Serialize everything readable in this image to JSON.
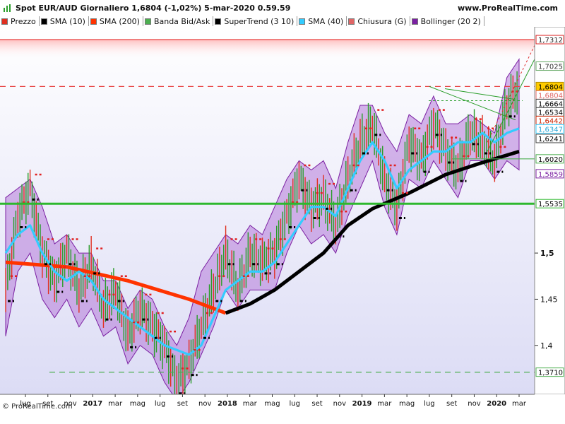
{
  "header": {
    "title": "Spot EUR/AUD Giornaliero 1,6804 (-1,02%) 5-mar-2020 0.59.59",
    "site": "www.ProRealTime.com"
  },
  "legend": [
    {
      "label": "Prezzo",
      "icon": "candle-icon",
      "color": "#e03020"
    },
    {
      "label": "SMA (10)",
      "icon": "sma10-icon",
      "color": "#000000"
    },
    {
      "label": "SMA (200)",
      "icon": "sma200-icon",
      "color": "#ff3300"
    },
    {
      "label": "Banda Bid/Ask",
      "icon": "bidask-icon",
      "color": "#4caf50"
    },
    {
      "label": "SuperTrend (3 10)",
      "icon": "supertrend-icon",
      "color": "#000000"
    },
    {
      "label": "SMA (40)",
      "icon": "sma40-icon",
      "color": "#33ccff"
    },
    {
      "label": "Chiusura (G)",
      "icon": "close-icon",
      "color": "#e06666"
    },
    {
      "label": "Bollinger (20 2)",
      "icon": "bollinger-icon",
      "color": "#7b1fa2"
    }
  ],
  "copyright": "© ProRealTime.com",
  "chart_data": {
    "type": "line",
    "ylim": [
      1.347,
      1.745
    ],
    "y_ticks": [
      "1,5",
      "1,45",
      "1,4"
    ],
    "y_tick_values": [
      1.5,
      1.45,
      1.4
    ],
    "x_labels": [
      "lug",
      "set",
      "nov",
      "2017",
      "mar",
      "mag",
      "lug",
      "set",
      "nov",
      "2018",
      "mar",
      "mag",
      "lug",
      "set",
      "nov",
      "2019",
      "mar",
      "mag",
      "lug",
      "set",
      "nov",
      "2020",
      "mar"
    ],
    "x_labels_bold": [
      "2017",
      "2018",
      "2019",
      "2020"
    ],
    "price_tags": [
      {
        "label": "1,7312",
        "value": 1.7312,
        "bg": "#ffffff",
        "fg": "#222222",
        "border": "#d22"
      },
      {
        "label": "1,7025",
        "value": 1.7025,
        "bg": "#ffffff",
        "fg": "#333333",
        "border": "#6a6"
      },
      {
        "label": "1,6804",
        "value": 1.6804,
        "bg": "#ffcc00",
        "fg": "#000000",
        "border": "#b08a00"
      },
      {
        "label": "1,6804",
        "value": 1.676,
        "bg": "#ffffff",
        "fg": "#e06666",
        "border": "#e06666"
      },
      {
        "label": "1,6664",
        "value": 1.6664,
        "bg": "#ffffff",
        "fg": "#000000",
        "border": "#444"
      },
      {
        "label": "1,6534",
        "value": 1.6534,
        "bg": "#ffffff",
        "fg": "#000000",
        "border": "#444"
      },
      {
        "label": "1,6442",
        "value": 1.6442,
        "bg": "#ffffff",
        "fg": "#cc2200",
        "border": "#cc2200"
      },
      {
        "label": "1,6347",
        "value": 1.6347,
        "bg": "#ffffff",
        "fg": "#2aa8d8",
        "border": "#33ccff"
      },
      {
        "label": "1,6241",
        "value": 1.6241,
        "bg": "#ffffff",
        "fg": "#000000",
        "border": "#444"
      },
      {
        "label": "1,6020",
        "value": 1.602,
        "bg": "#ffffff",
        "fg": "#000000",
        "border": "#4caf50"
      },
      {
        "label": "1,5859",
        "value": 1.5859,
        "bg": "#ffffff",
        "fg": "#7b1fa2",
        "border": "#7b1fa2"
      },
      {
        "label": "1,5535",
        "value": 1.5535,
        "bg": "#ffffff",
        "fg": "#000000",
        "border": "#2db82d"
      },
      {
        "label": "1,3710",
        "value": 1.371,
        "bg": "#ffffff",
        "fg": "#000000",
        "border": "#4caf50"
      }
    ],
    "levels": [
      {
        "value": 1.7312,
        "style": "solid",
        "color": "#e84040"
      },
      {
        "value": 1.6804,
        "style": "dashed",
        "color": "#e84040"
      },
      {
        "value": 1.5535,
        "style": "solid",
        "color": "#2db82d"
      },
      {
        "value": 1.602,
        "style": "solid",
        "color": "#4caf50"
      },
      {
        "value": 1.371,
        "style": "dashed",
        "color": "#4caf50"
      }
    ],
    "series": [
      {
        "name": "SMA (200)",
        "color": "#ff3300",
        "x": [
          0,
          5,
          10,
          15,
          18
        ],
        "y": [
          1.49,
          1.485,
          1.47,
          1.45,
          1.435
        ]
      },
      {
        "name": "SMA (200)",
        "color": "#000000",
        "x": [
          18,
          20,
          22,
          24,
          26,
          28,
          30,
          33,
          36,
          39,
          42
        ],
        "y": [
          1.435,
          1.445,
          1.46,
          1.48,
          1.5,
          1.53,
          1.548,
          1.565,
          1.585,
          1.598,
          1.61
        ]
      },
      {
        "name": "SMA (40)",
        "color": "#33ccff",
        "x": [
          0,
          1,
          2,
          3,
          4,
          5,
          6,
          7,
          8,
          9,
          10,
          11,
          12,
          13,
          14,
          15,
          16,
          17,
          18,
          19,
          20,
          21,
          22,
          23,
          24,
          25,
          26,
          27,
          28,
          29,
          30,
          31,
          32,
          33,
          34,
          35,
          36,
          37,
          38,
          39,
          40,
          41,
          42
        ],
        "y": [
          1.5,
          1.52,
          1.53,
          1.5,
          1.48,
          1.47,
          1.48,
          1.47,
          1.45,
          1.44,
          1.43,
          1.42,
          1.41,
          1.4,
          1.395,
          1.39,
          1.4,
          1.43,
          1.46,
          1.47,
          1.48,
          1.48,
          1.49,
          1.51,
          1.53,
          1.55,
          1.55,
          1.54,
          1.57,
          1.6,
          1.62,
          1.6,
          1.57,
          1.59,
          1.6,
          1.61,
          1.61,
          1.62,
          1.62,
          1.63,
          1.62,
          1.63,
          1.635
        ]
      }
    ],
    "candle_path": [
      1.46,
      1.54,
      1.57,
      1.5,
      1.47,
      1.5,
      1.46,
      1.49,
      1.44,
      1.46,
      1.41,
      1.44,
      1.42,
      1.4,
      1.36,
      1.38,
      1.42,
      1.46,
      1.5,
      1.46,
      1.5,
      1.49,
      1.5,
      1.54,
      1.58,
      1.55,
      1.56,
      1.53,
      1.58,
      1.62,
      1.64,
      1.58,
      1.55,
      1.62,
      1.6,
      1.64,
      1.61,
      1.59,
      1.63,
      1.62,
      1.6,
      1.66,
      1.68
    ],
    "bollinger_upper": [
      1.56,
      1.57,
      1.58,
      1.55,
      1.51,
      1.52,
      1.5,
      1.5,
      1.47,
      1.47,
      1.44,
      1.46,
      1.45,
      1.42,
      1.4,
      1.43,
      1.48,
      1.5,
      1.52,
      1.51,
      1.53,
      1.52,
      1.55,
      1.58,
      1.6,
      1.59,
      1.6,
      1.57,
      1.62,
      1.66,
      1.66,
      1.63,
      1.61,
      1.65,
      1.64,
      1.67,
      1.64,
      1.64,
      1.65,
      1.64,
      1.63,
      1.69,
      1.71
    ],
    "bollinger_lower": [
      1.41,
      1.48,
      1.5,
      1.45,
      1.43,
      1.45,
      1.42,
      1.44,
      1.41,
      1.42,
      1.38,
      1.4,
      1.39,
      1.36,
      1.34,
      1.36,
      1.39,
      1.42,
      1.46,
      1.44,
      1.46,
      1.46,
      1.46,
      1.5,
      1.53,
      1.51,
      1.52,
      1.5,
      1.54,
      1.57,
      1.6,
      1.55,
      1.52,
      1.58,
      1.57,
      1.6,
      1.58,
      1.56,
      1.6,
      1.6,
      1.58,
      1.6,
      1.59
    ]
  }
}
